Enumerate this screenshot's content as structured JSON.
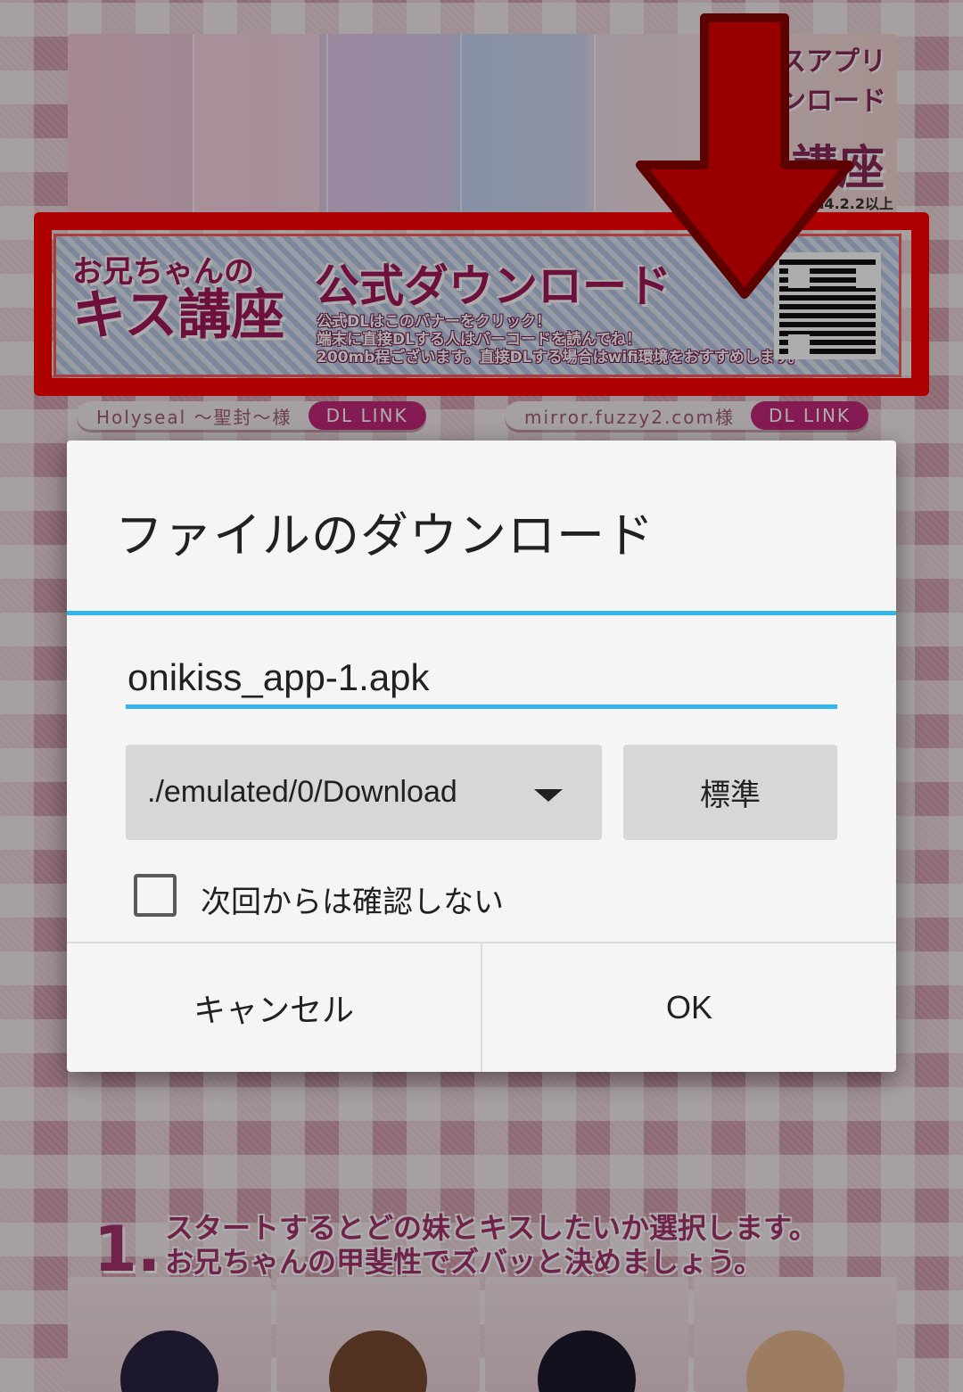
{
  "background_page": {
    "top_banner": {
      "heading_line1": "キスアプリ",
      "heading_line2": "ダウンロード",
      "title": "講座",
      "os_note": "oid4.2.2以上"
    },
    "download_banner": {
      "logo_line1": "お兄ちゃんの",
      "logo_line2": "キス講座",
      "title": "公式ダウンロード",
      "desc_line1": "公式DLはこのバナーをクリック！",
      "desc_line2": "端末に直接DLする人はバーコードを読んでね！",
      "desc_line3": "200mb程ございます。直接DLする場合はwifi環境をおすすめします。"
    },
    "mirror_links": [
      {
        "host": "Holyseal 〜聖封〜様",
        "button": "DL LINK"
      },
      {
        "host": "mirror.fuzzy2.com様",
        "button": "DL LINK"
      }
    ],
    "step": {
      "number": "1.",
      "line1": "スタートするとどの妹とキスしたいか選択します。",
      "line2": "お兄ちゃんの甲斐性でズバッと決めましょう。"
    }
  },
  "dialog": {
    "title": "ファイルのダウンロード",
    "filename": "onikiss_app-1.apk",
    "path": "./emulated/0/Download",
    "default_button": "標準",
    "checkbox_label": "次回からは確認しない",
    "checkbox_checked": false,
    "cancel_button": "キャンセル",
    "ok_button": "OK",
    "accent_color": "#33b5e5"
  },
  "annotations": {
    "highlight_color": "#ff0000"
  }
}
